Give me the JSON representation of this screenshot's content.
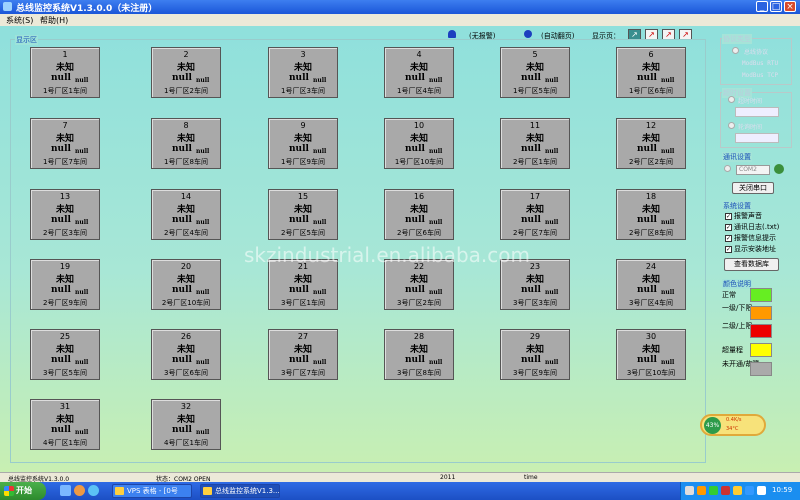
{
  "window": {
    "title": "总线监控系统V1.3.0.0（未注册）"
  },
  "menu": {
    "items": [
      "系统(S)",
      "帮助(H)"
    ]
  },
  "toolbar": {
    "alarm": "(无报警)",
    "auto_page": "(自动翻页)",
    "page_label": "显示页："
  },
  "display": {
    "label": "显示区",
    "tiles": [
      {
        "num": "1",
        "state": "未知",
        "v1": "null",
        "v2": "null",
        "loc": "1号厂区1车间"
      },
      {
        "num": "2",
        "state": "未知",
        "v1": "null",
        "v2": "null",
        "loc": "1号厂区2车间"
      },
      {
        "num": "3",
        "state": "未知",
        "v1": "null",
        "v2": "null",
        "loc": "1号厂区3车间"
      },
      {
        "num": "4",
        "state": "未知",
        "v1": "null",
        "v2": "null",
        "loc": "1号厂区4车间"
      },
      {
        "num": "5",
        "state": "未知",
        "v1": "null",
        "v2": "null",
        "loc": "1号厂区5车间"
      },
      {
        "num": "6",
        "state": "未知",
        "v1": "null",
        "v2": "null",
        "loc": "1号厂区6车间"
      },
      {
        "num": "7",
        "state": "未知",
        "v1": "null",
        "v2": "null",
        "loc": "1号厂区7车间"
      },
      {
        "num": "8",
        "state": "未知",
        "v1": "null",
        "v2": "null",
        "loc": "1号厂区8车间"
      },
      {
        "num": "9",
        "state": "未知",
        "v1": "null",
        "v2": "null",
        "loc": "1号厂区9车间"
      },
      {
        "num": "10",
        "state": "未知",
        "v1": "null",
        "v2": "null",
        "loc": "1号厂区10车间"
      },
      {
        "num": "11",
        "state": "未知",
        "v1": "null",
        "v2": "null",
        "loc": "2号厂区1车间"
      },
      {
        "num": "12",
        "state": "未知",
        "v1": "null",
        "v2": "null",
        "loc": "2号厂区2车间"
      },
      {
        "num": "13",
        "state": "未知",
        "v1": "null",
        "v2": "null",
        "loc": "2号厂区3车间"
      },
      {
        "num": "14",
        "state": "未知",
        "v1": "null",
        "v2": "null",
        "loc": "2号厂区4车间"
      },
      {
        "num": "15",
        "state": "未知",
        "v1": "null",
        "v2": "null",
        "loc": "2号厂区5车间"
      },
      {
        "num": "16",
        "state": "未知",
        "v1": "null",
        "v2": "null",
        "loc": "2号厂区6车间"
      },
      {
        "num": "17",
        "state": "未知",
        "v1": "null",
        "v2": "null",
        "loc": "2号厂区7车间"
      },
      {
        "num": "18",
        "state": "未知",
        "v1": "null",
        "v2": "null",
        "loc": "2号厂区8车间"
      },
      {
        "num": "19",
        "state": "未知",
        "v1": "null",
        "v2": "null",
        "loc": "2号厂区9车间"
      },
      {
        "num": "20",
        "state": "未知",
        "v1": "null",
        "v2": "null",
        "loc": "2号厂区10车间"
      },
      {
        "num": "21",
        "state": "未知",
        "v1": "null",
        "v2": "null",
        "loc": "3号厂区1车间"
      },
      {
        "num": "22",
        "state": "未知",
        "v1": "null",
        "v2": "null",
        "loc": "3号厂区2车间"
      },
      {
        "num": "23",
        "state": "未知",
        "v1": "null",
        "v2": "null",
        "loc": "3号厂区3车间"
      },
      {
        "num": "24",
        "state": "未知",
        "v1": "null",
        "v2": "null",
        "loc": "3号厂区4车间"
      },
      {
        "num": "25",
        "state": "未知",
        "v1": "null",
        "v2": "null",
        "loc": "3号厂区5车间"
      },
      {
        "num": "26",
        "state": "未知",
        "v1": "null",
        "v2": "null",
        "loc": "3号厂区6车间"
      },
      {
        "num": "27",
        "state": "未知",
        "v1": "null",
        "v2": "null",
        "loc": "3号厂区7车间"
      },
      {
        "num": "28",
        "state": "未知",
        "v1": "null",
        "v2": "null",
        "loc": "3号厂区8车间"
      },
      {
        "num": "29",
        "state": "未知",
        "v1": "null",
        "v2": "null",
        "loc": "3号厂区9车间"
      },
      {
        "num": "30",
        "state": "未知",
        "v1": "null",
        "v2": "null",
        "loc": "3号厂区10车间"
      },
      {
        "num": "31",
        "state": "未知",
        "v1": "null",
        "v2": "null",
        "loc": "4号厂区1车间"
      },
      {
        "num": "32",
        "state": "未知",
        "v1": "null",
        "v2": "null",
        "loc": "4号厂区1车间"
      }
    ]
  },
  "right_panel": {
    "protocol": {
      "title": "协议类型",
      "options": [
        "总线协议",
        "ModBus RTU",
        "ModBus TCP"
      ]
    },
    "timeout": {
      "title": "超时设置",
      "label_1": "超时时间",
      "label_2": "轮询时间"
    },
    "comm": {
      "title": "通讯设置",
      "port": "COM2",
      "close_button": "关闭串口"
    },
    "system": {
      "title": "系统设置",
      "checkboxes": [
        "报警声音",
        "通讯日志(.txt)",
        "报警信息提示",
        "显示安装地址"
      ],
      "db_button": "查看数据库"
    },
    "colors": {
      "title": "颜色说明",
      "items": [
        {
          "label": "正常",
          "color": "#66ee22"
        },
        {
          "label": "一级/下限",
          "color": "#ff9900"
        },
        {
          "label": "二级/上限",
          "color": "#ee0000"
        },
        {
          "label": "超量程",
          "color": "#ffff00"
        },
        {
          "label": "未开通/故障",
          "color": "#aaaaaa"
        }
      ]
    }
  },
  "gauge": {
    "percent": "43%",
    "rate_1": "0.4K/s",
    "rate_2": "34°C"
  },
  "statusbar": {
    "app": "总线监控系统V1.3.0.0",
    "state": "状态：COM2 OPEN",
    "value": "2011",
    "time": "time"
  },
  "taskbar": {
    "start": "开始",
    "tasks": [
      "VPS 表格 - [0号",
      "总线监控系统V1.3..."
    ],
    "clock": "10:59"
  },
  "watermark": "skzindustrial.en.alibaba.com",
  "colors": {
    "titlebar": "#1a56d8",
    "tile": "#a9a9a9",
    "bg_top": "#8fe0dc",
    "bg_bottom": "#c8efb2"
  }
}
